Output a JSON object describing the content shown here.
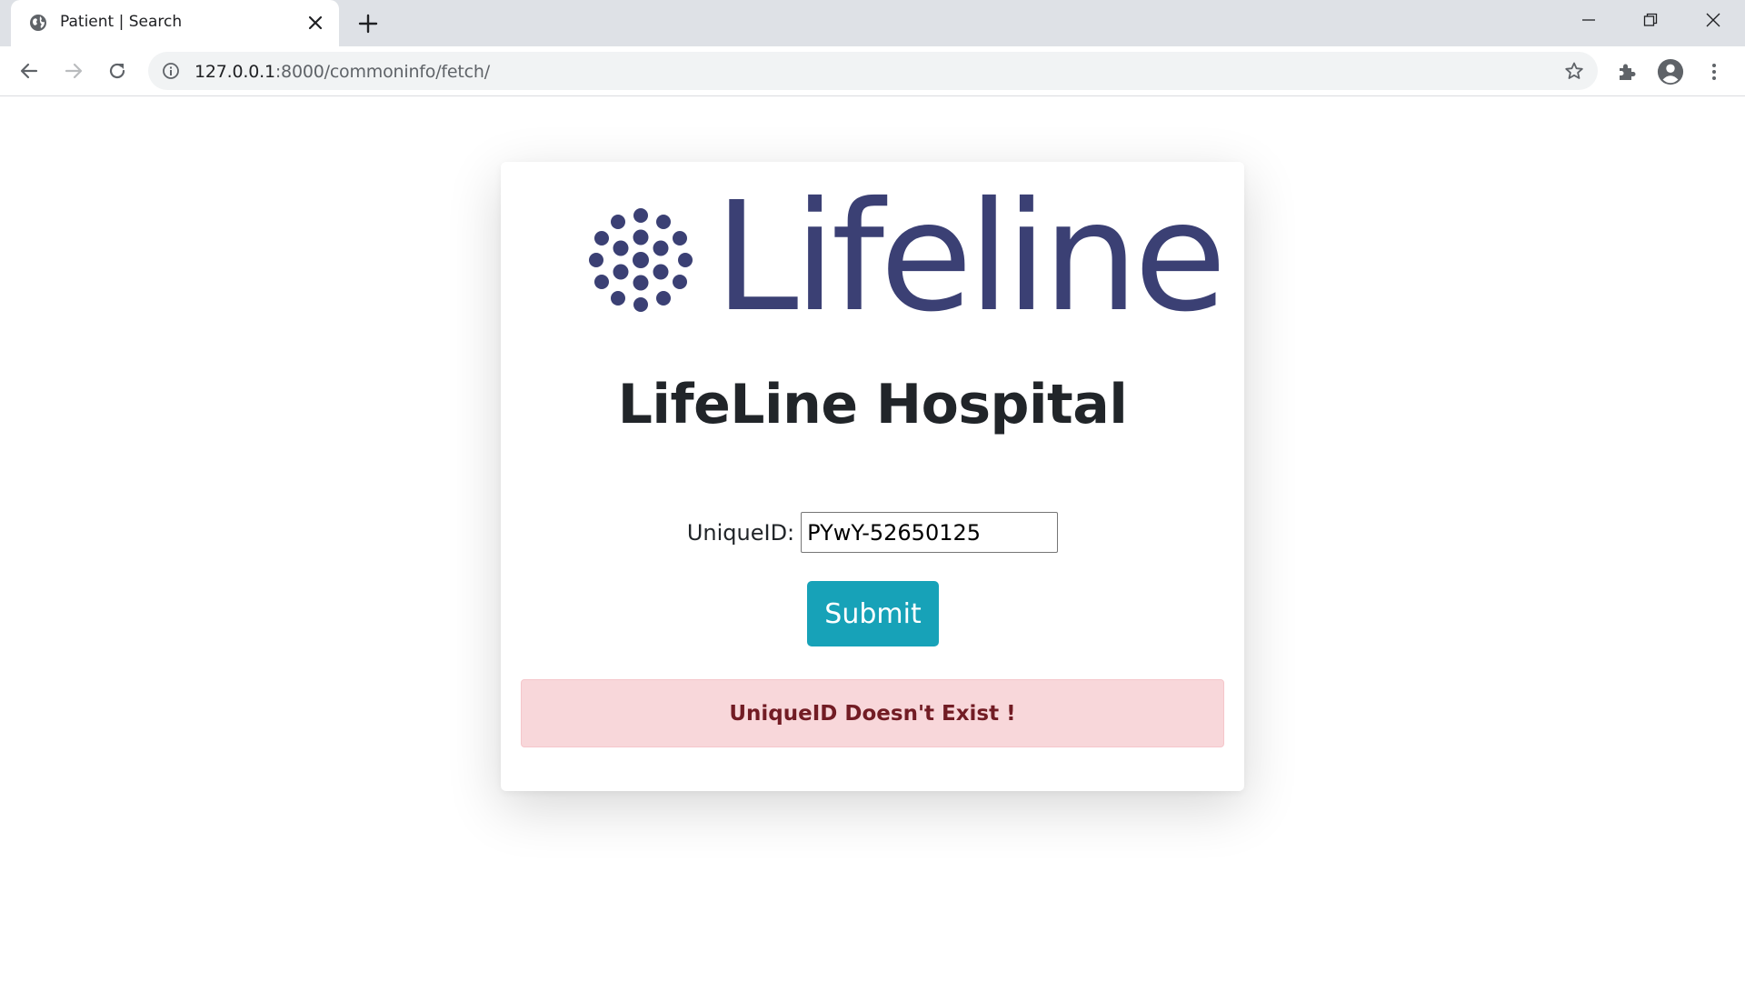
{
  "browser": {
    "tab_title": "Patient | Search",
    "url_host": "127.0.0.1",
    "url_path": ":8000/commoninfo/fetch/",
    "icons": [
      "globe-icon",
      "close-icon",
      "plus-icon",
      "minimize-icon",
      "restore-icon",
      "close-window-icon",
      "back-arrow-icon",
      "forward-arrow-icon",
      "reload-icon",
      "info-icon",
      "star-icon",
      "puzzle-icon",
      "account-icon",
      "more-vert-icon"
    ]
  },
  "page": {
    "logo_text": "Lifeline",
    "title": "LifeLine Hospital",
    "form": {
      "label": "UniqueID:",
      "value": "PYwY-52650125",
      "submit_label": "Submit"
    },
    "alert": {
      "message": "UniqueID Doesn't Exist !"
    }
  },
  "colors": {
    "brand_navy": "#3b4074",
    "button_teal": "#17a2b8",
    "alert_bg": "#f8d7da",
    "alert_text": "#721c24"
  }
}
